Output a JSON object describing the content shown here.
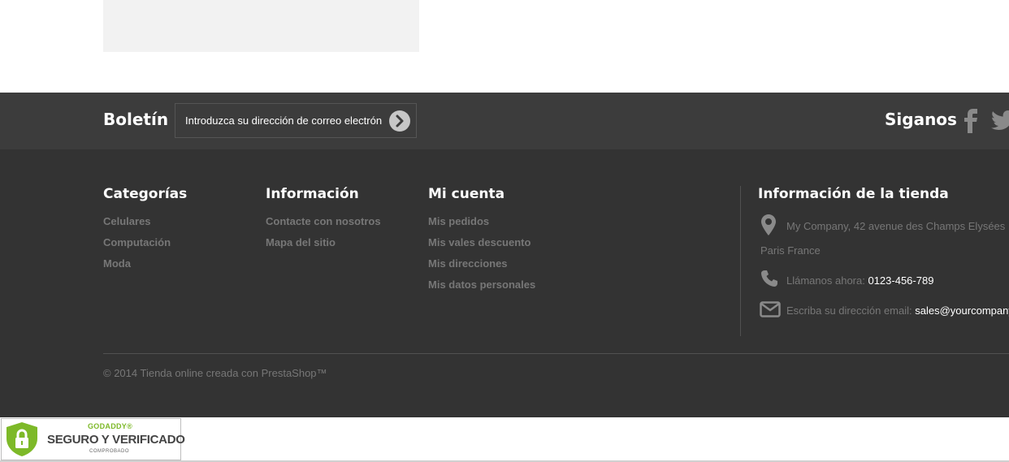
{
  "newsletter": {
    "title": "Boletín",
    "placeholder": "Introduzca su dirección de correo electrón"
  },
  "social": {
    "title": "Siganos",
    "icons": [
      "facebook-icon",
      "twitter-icon"
    ]
  },
  "columns": {
    "categorias": {
      "title": "Categorías",
      "items": [
        "Celulares",
        "Computación",
        "Moda"
      ]
    },
    "informacion": {
      "title": "Información",
      "items": [
        "Contacte con nosotros",
        "Mapa del sitio"
      ]
    },
    "mi_cuenta": {
      "title": "Mi cuenta",
      "items": [
        "Mis pedidos",
        "Mis vales descuento",
        "Mis direcciones",
        "Mis datos personales"
      ]
    }
  },
  "store": {
    "title": "Información de la tienda",
    "address_line1": "My Company, 42 avenue des Champs Elysées",
    "address_line2": "Paris France",
    "phone_label": "Llámanos ahora:",
    "phone": "0123-456-789",
    "email_label": "Escriba su dirección email:",
    "email": "sales@yourcompany"
  },
  "copyright": "© 2014 Tienda online creada con PrestaShop™",
  "badge": {
    "brand": "GODADDY®",
    "main": "SEGURO Y VERIFICADO",
    "sub": "COMPROBADO"
  },
  "colors": {
    "newsletter_bg": "#3c3c3c",
    "footer_bg": "#333333",
    "muted_text": "#777777",
    "badge_green": "#7db928"
  }
}
